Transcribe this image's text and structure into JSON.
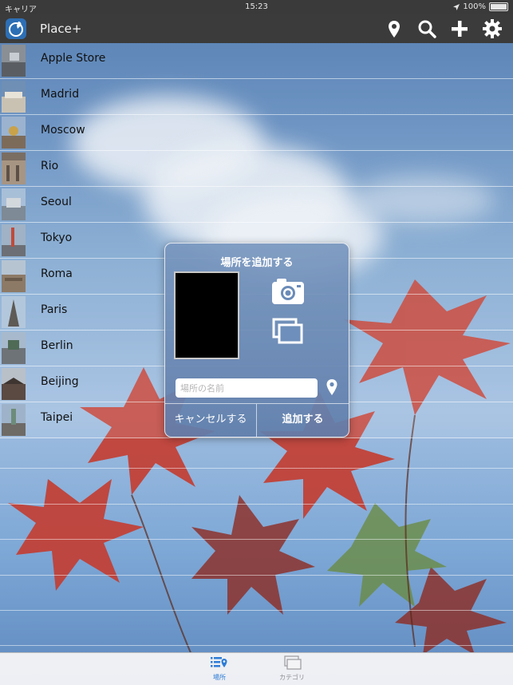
{
  "status_bar": {
    "carrier": "キャリア",
    "time": "15:23",
    "battery": "100%"
  },
  "nav": {
    "title": "Place+",
    "icons": [
      "location-pin-icon",
      "search-icon",
      "plus-icon",
      "gear-icon"
    ]
  },
  "places": [
    {
      "name": "Apple Store"
    },
    {
      "name": "Madrid"
    },
    {
      "name": "Moscow"
    },
    {
      "name": "Rio"
    },
    {
      "name": "Seoul"
    },
    {
      "name": "Tokyo"
    },
    {
      "name": "Roma"
    },
    {
      "name": "Paris"
    },
    {
      "name": "Berlin"
    },
    {
      "name": "Beijing"
    },
    {
      "name": "Taipei"
    }
  ],
  "dialog": {
    "title": "場所を追加する",
    "name_placeholder": "場所の名前",
    "name_value": "",
    "cancel_label": "キャンセルする",
    "add_label": "追加する"
  },
  "tabs": [
    {
      "label": "場所",
      "icon": "list-pin-icon",
      "selected": true
    },
    {
      "label": "カテゴリ",
      "icon": "stack-icon",
      "selected": false
    }
  ],
  "colors": {
    "accent": "#2e7cd6",
    "navbar": "#3b3b3b",
    "tab_inactive": "#8e8e93"
  }
}
